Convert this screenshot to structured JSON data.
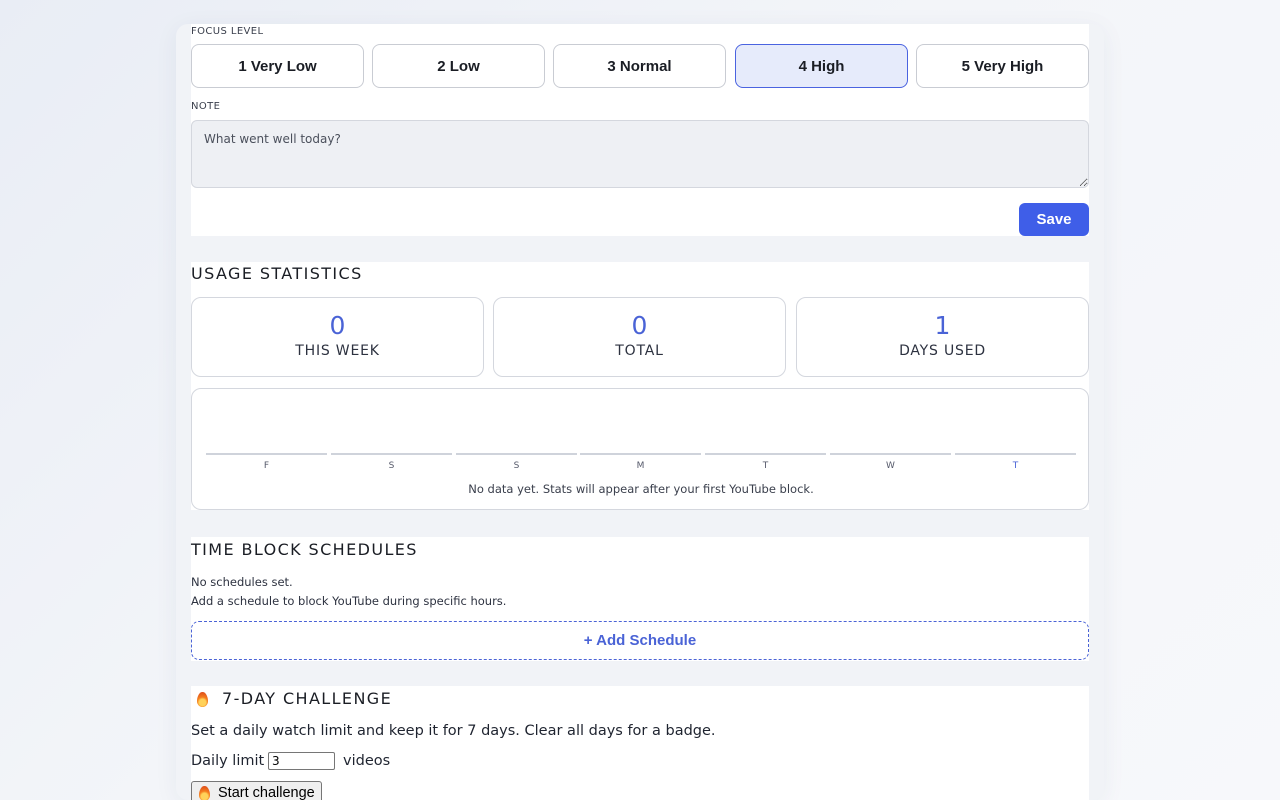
{
  "focus": {
    "label": "FOCUS LEVEL",
    "levels": [
      {
        "label": "1 Very Low",
        "selected": false
      },
      {
        "label": "2 Low",
        "selected": false
      },
      {
        "label": "3 Normal",
        "selected": false
      },
      {
        "label": "4 High",
        "selected": true
      },
      {
        "label": "5 Very High",
        "selected": false
      }
    ],
    "note_label": "NOTE",
    "note_placeholder": "What went well today?",
    "save_label": "Save"
  },
  "usage": {
    "title": "USAGE STATISTICS",
    "stats": [
      {
        "value": "0",
        "label": "THIS WEEK"
      },
      {
        "value": "0",
        "label": "TOTAL"
      },
      {
        "value": "1",
        "label": "DAYS USED"
      }
    ],
    "days": [
      "F",
      "S",
      "S",
      "M",
      "T",
      "W",
      "T"
    ],
    "empty_note": "No data yet. Stats will appear after your first YouTube block."
  },
  "schedules": {
    "title": "TIME BLOCK SCHEDULES",
    "empty_line1": "No schedules set.",
    "empty_line2": "Add a schedule to block YouTube during specific hours.",
    "add_label": "+ Add Schedule"
  },
  "challenge": {
    "title": "7-DAY CHALLENGE",
    "description": "Set a daily watch limit and keep it for 7 days. Clear all days for a badge.",
    "limit_label": "Daily limit",
    "limit_value": "3",
    "limit_unit": "videos",
    "start_label": "Start challenge"
  },
  "colors": {
    "accent": "#3f5ee8",
    "stat_value": "#4a63d6",
    "selected_bg": "#e6ebfb"
  }
}
